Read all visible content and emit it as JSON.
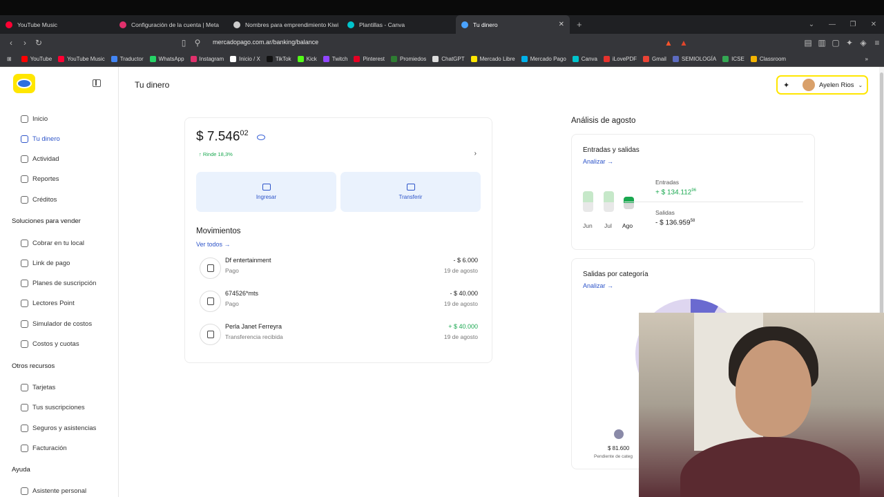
{
  "browser": {
    "tabs": [
      {
        "label": "YouTube Music",
        "color": "#ff0033"
      },
      {
        "label": "Configuración de la cuenta | Meta",
        "color": "#e1306c"
      },
      {
        "label": "Nombres para emprendimiento Kiwi",
        "color": "#cccccc"
      },
      {
        "label": "Plantillas - Canva",
        "color": "#00c4cc"
      },
      {
        "label": "Tu dinero",
        "color": "#4aa3ff"
      }
    ],
    "url": "mercadopago.com.ar/banking/balance",
    "bookmarks": [
      {
        "label": "YouTube",
        "color": "#ff0000"
      },
      {
        "label": "YouTube Music",
        "color": "#ff0033"
      },
      {
        "label": "Traductor",
        "color": "#4285f4"
      },
      {
        "label": "WhatsApp",
        "color": "#25d366"
      },
      {
        "label": "Instagram",
        "color": "#e1306c"
      },
      {
        "label": "Inicio / X",
        "color": "#ffffff"
      },
      {
        "label": "TikTok",
        "color": "#111111"
      },
      {
        "label": "Kick",
        "color": "#53fc18"
      },
      {
        "label": "Twitch",
        "color": "#9146ff"
      },
      {
        "label": "Pinterest",
        "color": "#e60023"
      },
      {
        "label": "Promiedos",
        "color": "#2e7d32"
      },
      {
        "label": "ChatGPT",
        "color": "#dddddd"
      },
      {
        "label": "Mercado Libre",
        "color": "#ffe600"
      },
      {
        "label": "Mercado Pago",
        "color": "#00b1ea"
      },
      {
        "label": "Canva",
        "color": "#00c4cc"
      },
      {
        "label": "iLovePDF",
        "color": "#e5322d"
      },
      {
        "label": "Gmail",
        "color": "#ea4335"
      },
      {
        "label": "SEMIOLOGÍA",
        "color": "#5c6bc0"
      },
      {
        "label": "ICSE",
        "color": "#34a853"
      },
      {
        "label": "Classroom",
        "color": "#f4b400"
      }
    ]
  },
  "sidebar": {
    "items": [
      {
        "label": "Inicio"
      },
      {
        "label": "Tu dinero"
      },
      {
        "label": "Actividad"
      },
      {
        "label": "Reportes"
      },
      {
        "label": "Créditos"
      }
    ],
    "section_sell": "Soluciones para vender",
    "sell_items": [
      {
        "label": "Cobrar en tu local"
      },
      {
        "label": "Link de pago"
      },
      {
        "label": "Planes de suscripción"
      },
      {
        "label": "Lectores Point"
      },
      {
        "label": "Simulador de costos"
      },
      {
        "label": "Costos y cuotas"
      }
    ],
    "section_other": "Otros recursos",
    "other_items": [
      {
        "label": "Tarjetas"
      },
      {
        "label": "Tus suscripciones"
      },
      {
        "label": "Seguros y asistencias"
      },
      {
        "label": "Facturación"
      }
    ],
    "section_help": "Ayuda",
    "help_items": [
      {
        "label": "Asistente personal"
      }
    ]
  },
  "header": {
    "title": "Tu dinero",
    "user": "Ayelen Rios"
  },
  "balance": {
    "amount": "$ 7.546",
    "cents": "02",
    "rinde": "↑ Rinde 18,3%",
    "ingresar": "Ingresar",
    "transferir": "Transferir"
  },
  "movimientos": {
    "title": "Movimientos",
    "ver_todos": "Ver todos →",
    "items": [
      {
        "name": "Df entertainment",
        "type": "Pago",
        "amount": "- $ 6.000",
        "date": "19 de agosto"
      },
      {
        "name": "674526*mts",
        "type": "Pago",
        "amount": "- $ 40.000",
        "date": "19 de agosto"
      },
      {
        "name": "Perla Janet Ferreyra",
        "type": "Transferencia recibida",
        "amount": "+ $ 40.000",
        "date": "19 de agosto"
      }
    ]
  },
  "analisis": {
    "title": "Análisis de agosto",
    "es_title": "Entradas y salidas",
    "analizar": "Analizar →",
    "months": [
      "Jun",
      "Jul",
      "Ago"
    ],
    "entradas_label": "Entradas",
    "entradas_value": "+ $ 134.112",
    "entradas_cents": "96",
    "salidas_label": "Salidas",
    "salidas_value": "- $ 136.959",
    "salidas_cents": "58",
    "cat_title": "Salidas por categoría",
    "cat_amount": "$ 81.600",
    "cat_pending": "Pendiente de categ"
  },
  "colors": {
    "accent": "#2d54c9",
    "brand_yellow": "#ffe600",
    "positive": "#1aa850"
  }
}
